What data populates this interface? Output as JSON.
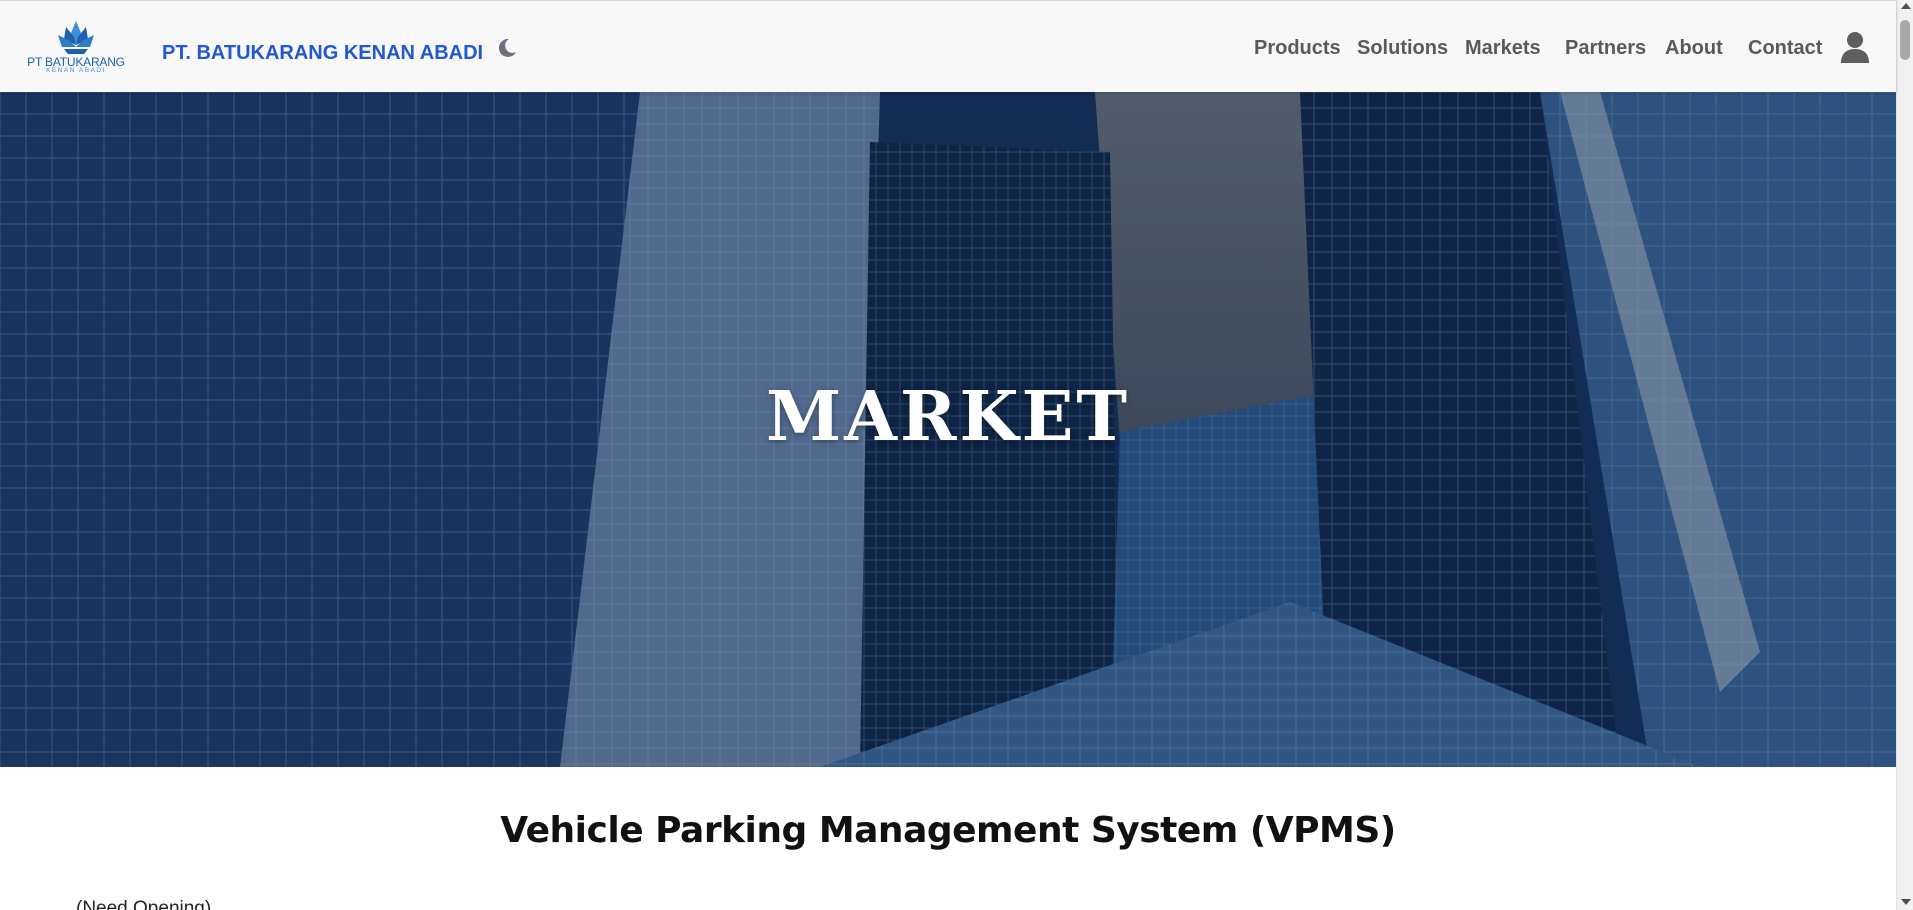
{
  "header": {
    "logo": {
      "name": "PT BATUKARANG",
      "tagline": "KENAN ABADI",
      "icon": "lotus-logo-icon"
    },
    "brand_name": "PT. BATUKARANG KENAN ABADI",
    "theme_toggle_icon": "moon-icon",
    "nav": [
      "Products",
      "Solutions",
      "Markets",
      "Partners",
      "About",
      "Contact"
    ],
    "user_icon": "user-icon"
  },
  "hero": {
    "title": "MARKET",
    "image": "glass skyscrapers"
  },
  "section": {
    "title": "Vehicle Parking Management System (VPMS)",
    "text": "(Need Opening)"
  },
  "colors": {
    "brand": "#2258d1",
    "nav_text": "#5a5a5a",
    "hero_overlay": "#163159"
  }
}
